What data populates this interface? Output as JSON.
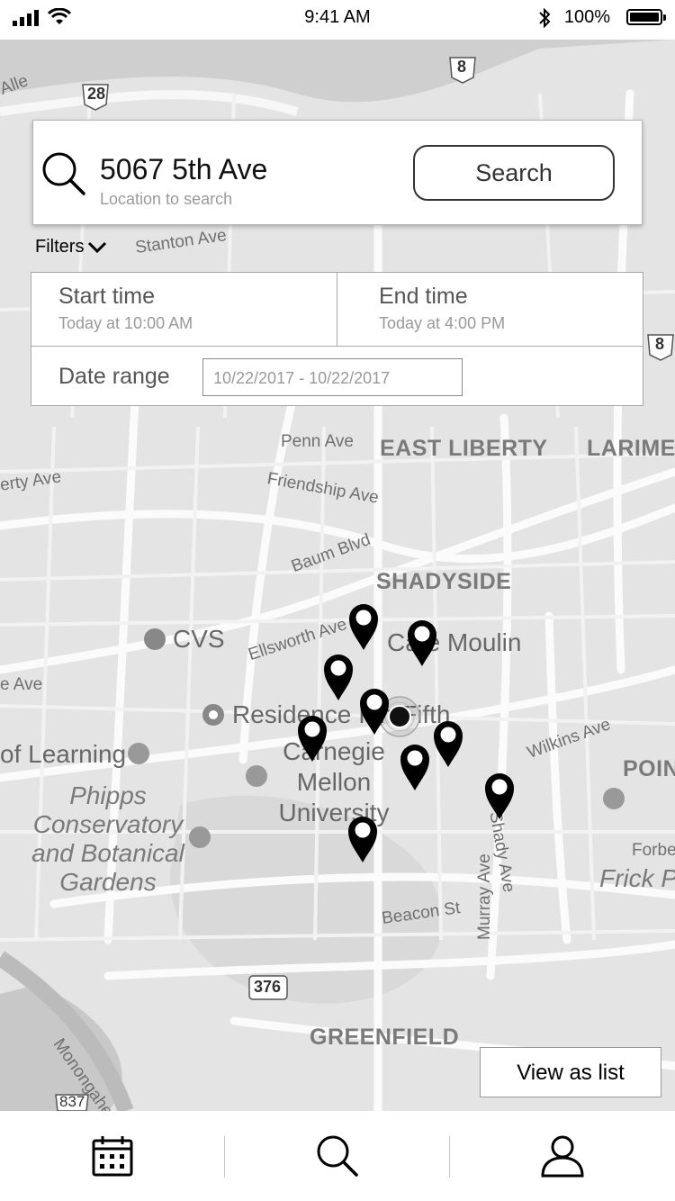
{
  "status_bar": {
    "time": "9:41 AM",
    "battery_percent": "100%",
    "icons": [
      "signal-icon",
      "wifi-icon",
      "bluetooth-icon",
      "battery-icon"
    ]
  },
  "search": {
    "value": "5067 5th Ave",
    "placeholder": "Location to search",
    "button_label": "Search",
    "icon": "search-icon"
  },
  "filters": {
    "label": "Filters",
    "icon": "chevron-down-icon",
    "start_time": {
      "label": "Start time",
      "value": "Today at 10:00 AM"
    },
    "end_time": {
      "label": "End time",
      "value": "Today at 4:00 PM"
    },
    "date_range": {
      "label": "Date range",
      "value": "10/22/2017 - 10/22/2017"
    }
  },
  "map": {
    "labels": {
      "east_liberty": "EAST LIBERTY",
      "larimer": "LARIMER",
      "shadyside": "SHADYSIDE",
      "greenfield": "GREENFIELD",
      "point": "POINT",
      "penn_ave": "Penn Ave",
      "friendship_ave": "Friendship Ave",
      "baum_blvd": "Baum Blvd",
      "ellsworth_ave": "Ellsworth Ave",
      "stanton_ave": "Stanton Ave",
      "liberty_ave": "erty Ave",
      "e_ave": "e Ave",
      "wilkins_ave": "Wilkins Ave",
      "shady_ave": "Shady Ave",
      "murray_ave": "Murray Ave",
      "beacon_st": "Beacon St",
      "forbes": "Forbe",
      "cvs": "CVS",
      "cafe_moulin": "Café Moulin",
      "residence": "Residence Inn",
      "fifth": "Fifth",
      "cathedral": "of Learning",
      "carnegie_mellon": "Carnegie Mellon University",
      "phipps": "Phipps Conservatory and Botanical Gardens",
      "frick": "Frick P",
      "monongahela": "Monongahela",
      "allegheny": "Alle",
      "route_28": "28",
      "route_8a": "8",
      "route_8b": "8",
      "route_376": "376",
      "route_837": "837"
    },
    "pin_count": 10
  },
  "view_list_label": "View as list",
  "tabs": [
    {
      "name": "calendar",
      "icon": "calendar-icon"
    },
    {
      "name": "search",
      "icon": "search-icon"
    },
    {
      "name": "profile",
      "icon": "profile-icon"
    }
  ]
}
